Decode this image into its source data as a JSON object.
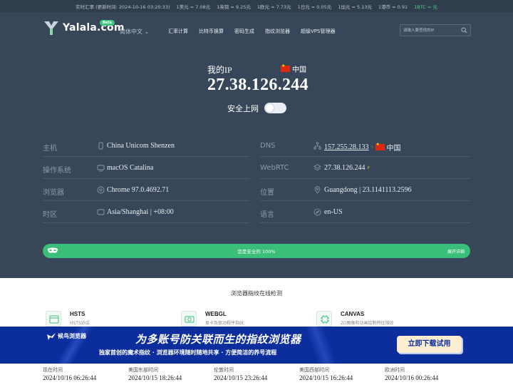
{
  "ticker": {
    "label": "实时汇率 (更新时间: 2024-10-16 03:20:33)",
    "rates": [
      "1美元 = 7.08元",
      "1英镑 = 9.25元",
      "1欧元 = 7.73元",
      "1日元 = 0.05元",
      "1加元 = 5.13元",
      "1港币 = 0.91"
    ],
    "btc": "1BTC = 元"
  },
  "header": {
    "logo_text": "Yalala.com",
    "beta": "Beta",
    "lang": "简体中文 ⌄",
    "nav": [
      "汇率计算",
      "比特币换算",
      "密码生成",
      "指纹浏览器",
      "超级VPS管理器"
    ],
    "search_placeholder": "请输入要查找的IP"
  },
  "hero": {
    "myip_label": "我的IP",
    "country": "中国",
    "ip": "27.38.126.244",
    "safe_label": "安全上网"
  },
  "info": {
    "host_label": "主机",
    "host": "China Unicom Shenzen",
    "os_label": "操作系统",
    "os": "macOS Catalina",
    "browser_label": "浏览器",
    "browser": "Chrome 97.0.4692.71",
    "tz_label": "时区",
    "tz": "Asia/Shanghai | +08:00",
    "dns_label": "DNS",
    "dns": "157.255.28.133",
    "dns_sup": "↑",
    "dns_country": "中国",
    "webrtc_label": "WebRTC",
    "webrtc": "27.38.126.244",
    "webrtc_sup": "P",
    "loc_label": "位置",
    "loc": "Guangdong | 23.1141113.2596",
    "lang_label": "语言",
    "lang": "en-US"
  },
  "safebar": {
    "text": "您是安全的 100%",
    "more": "展开详细"
  },
  "fingerprint": {
    "title": "浏览器指纹在线检测",
    "items": [
      {
        "name": "HSTS",
        "desc": "HSTS协议"
      },
      {
        "name": "WEBGL",
        "desc": "显卡及驱动程序指纹"
      },
      {
        "name": "CANVAS",
        "desc": "2D图像和动画绘制特征指纹"
      }
    ]
  },
  "banner": {
    "logo": "候鸟浏览器",
    "title": "为多账号防关联而生的指纹浏览器",
    "subtitle": "独家首创的魔术指纹 · 浏览器环境随时随地共享 · 方便简洁的养号流程",
    "button": "立即下载试用"
  },
  "times": [
    {
      "label": "现在时间",
      "value": "2024/10/16 06:26:44"
    },
    {
      "label": "美国东部时间",
      "value": "2024/10/15 18:26:44"
    },
    {
      "label": "伦敦时间",
      "value": "2024/10/15 23:26:44"
    },
    {
      "label": "美国西部时间",
      "value": "2024/10/15 16:26:44"
    },
    {
      "label": "欧洲时间",
      "value": "2024/10/16 00:26:44"
    }
  ]
}
